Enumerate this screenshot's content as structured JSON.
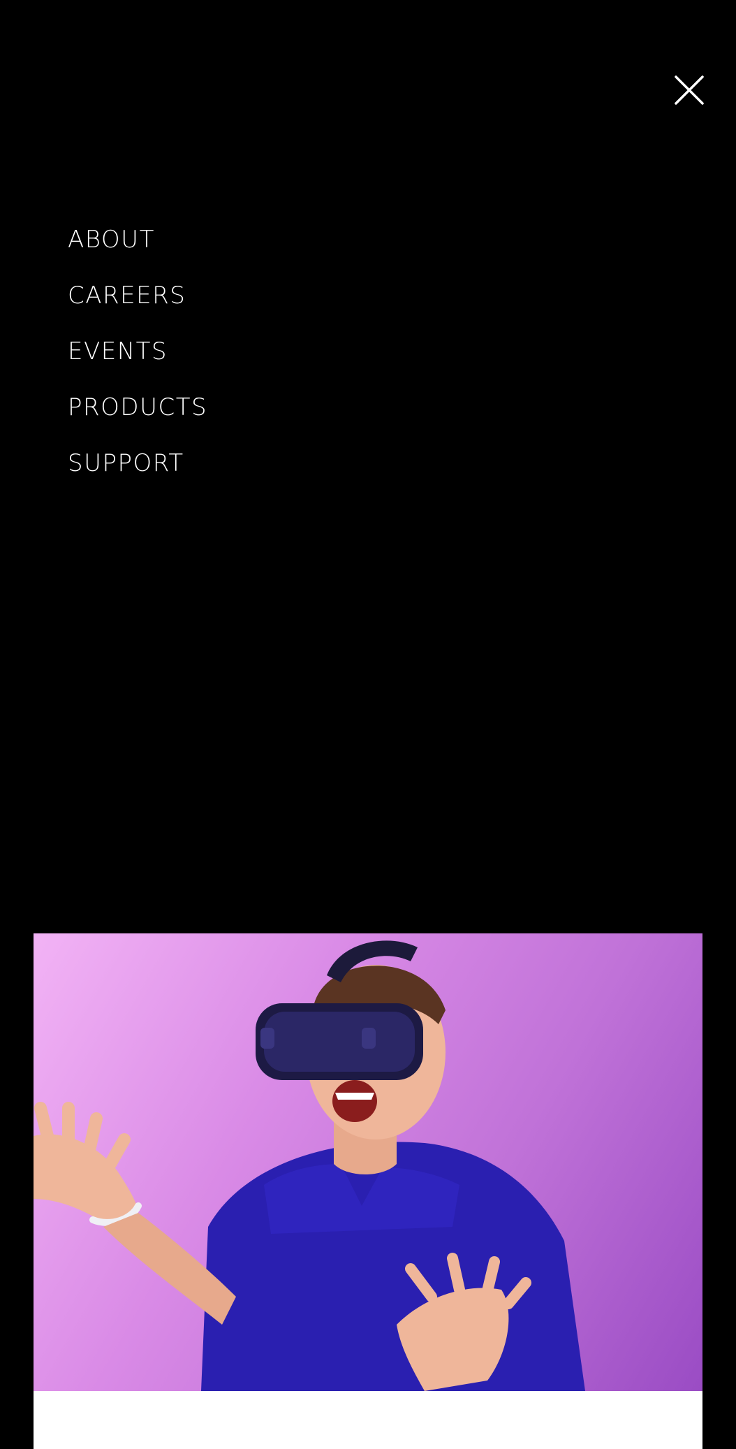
{
  "nav": {
    "close_icon": "close-icon",
    "items": [
      {
        "label": "ABOUT"
      },
      {
        "label": "CAREERS"
      },
      {
        "label": "EVENTS"
      },
      {
        "label": "PRODUCTS"
      },
      {
        "label": "SUPPORT"
      }
    ]
  },
  "hero": {
    "subject": "person-wearing-vr-headset"
  },
  "colors": {
    "background": "#000000",
    "menu_text": "#ffffff",
    "hero_bg_start": "#f2b3f5",
    "hero_bg_end": "#9a4cc4",
    "shirt": "#2a1fb0",
    "card": "#ffffff"
  }
}
